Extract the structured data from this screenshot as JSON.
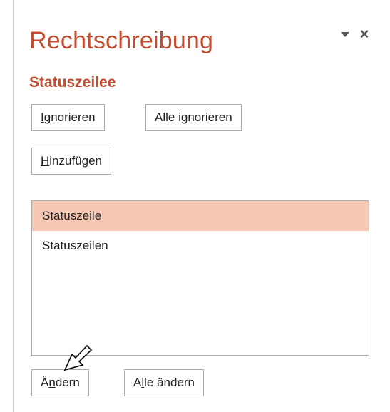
{
  "pane": {
    "title": "Rechtschreibung",
    "close_glyph": "×"
  },
  "error_word": "Statuszeilee",
  "buttons": {
    "ignore": {
      "key": "I",
      "rest": "gnorieren"
    },
    "ignore_all": {
      "pre": "Alle i",
      "key": "g",
      "rest": "norieren"
    },
    "add": {
      "key": "H",
      "rest": "inzufügen"
    },
    "change": {
      "pre": "Ä",
      "key": "n",
      "rest": "dern"
    },
    "change_all": {
      "pre": "A",
      "key": "l",
      "rest": "le ändern"
    }
  },
  "suggestions": [
    {
      "label": "Statuszeile",
      "selected": true
    },
    {
      "label": "Statuszeilen",
      "selected": false
    }
  ],
  "colors": {
    "accent": "#c24d30",
    "selection": "#f6c8b4"
  },
  "icons": {
    "pane_menu": "dropdown-triangle-icon",
    "close": "close-icon",
    "cursor": "arrow-cursor-icon"
  }
}
